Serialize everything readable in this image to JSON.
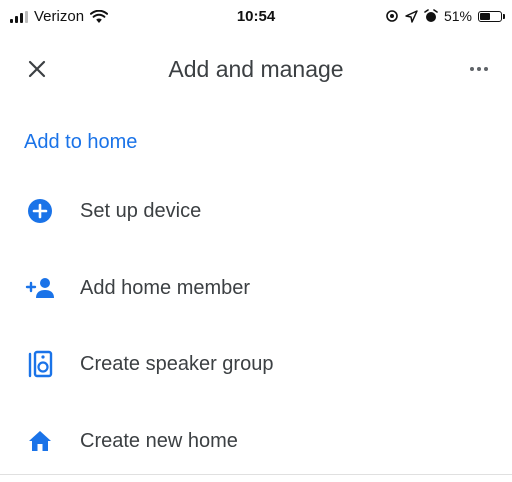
{
  "status_bar": {
    "carrier": "Verizon",
    "time": "10:54",
    "battery": "51%",
    "battery_level": 0.51,
    "icons": [
      "signal-icon",
      "wifi-icon",
      "location-target-icon",
      "location-arrow-icon",
      "alarm-icon",
      "battery-icon"
    ]
  },
  "app_bar": {
    "title": "Add and manage",
    "close_icon": "close-icon",
    "more_icon": "more-horizontal-icon"
  },
  "section": {
    "title": "Add to home"
  },
  "menu": {
    "items": [
      {
        "label": "Set up device",
        "icon": "add-circle-icon"
      },
      {
        "label": "Add home member",
        "icon": "add-person-icon"
      },
      {
        "label": "Create speaker group",
        "icon": "speaker-icon"
      },
      {
        "label": "Create new home",
        "icon": "home-icon"
      }
    ]
  },
  "colors": {
    "accent": "#1a73e8",
    "text": "#3c4043"
  }
}
